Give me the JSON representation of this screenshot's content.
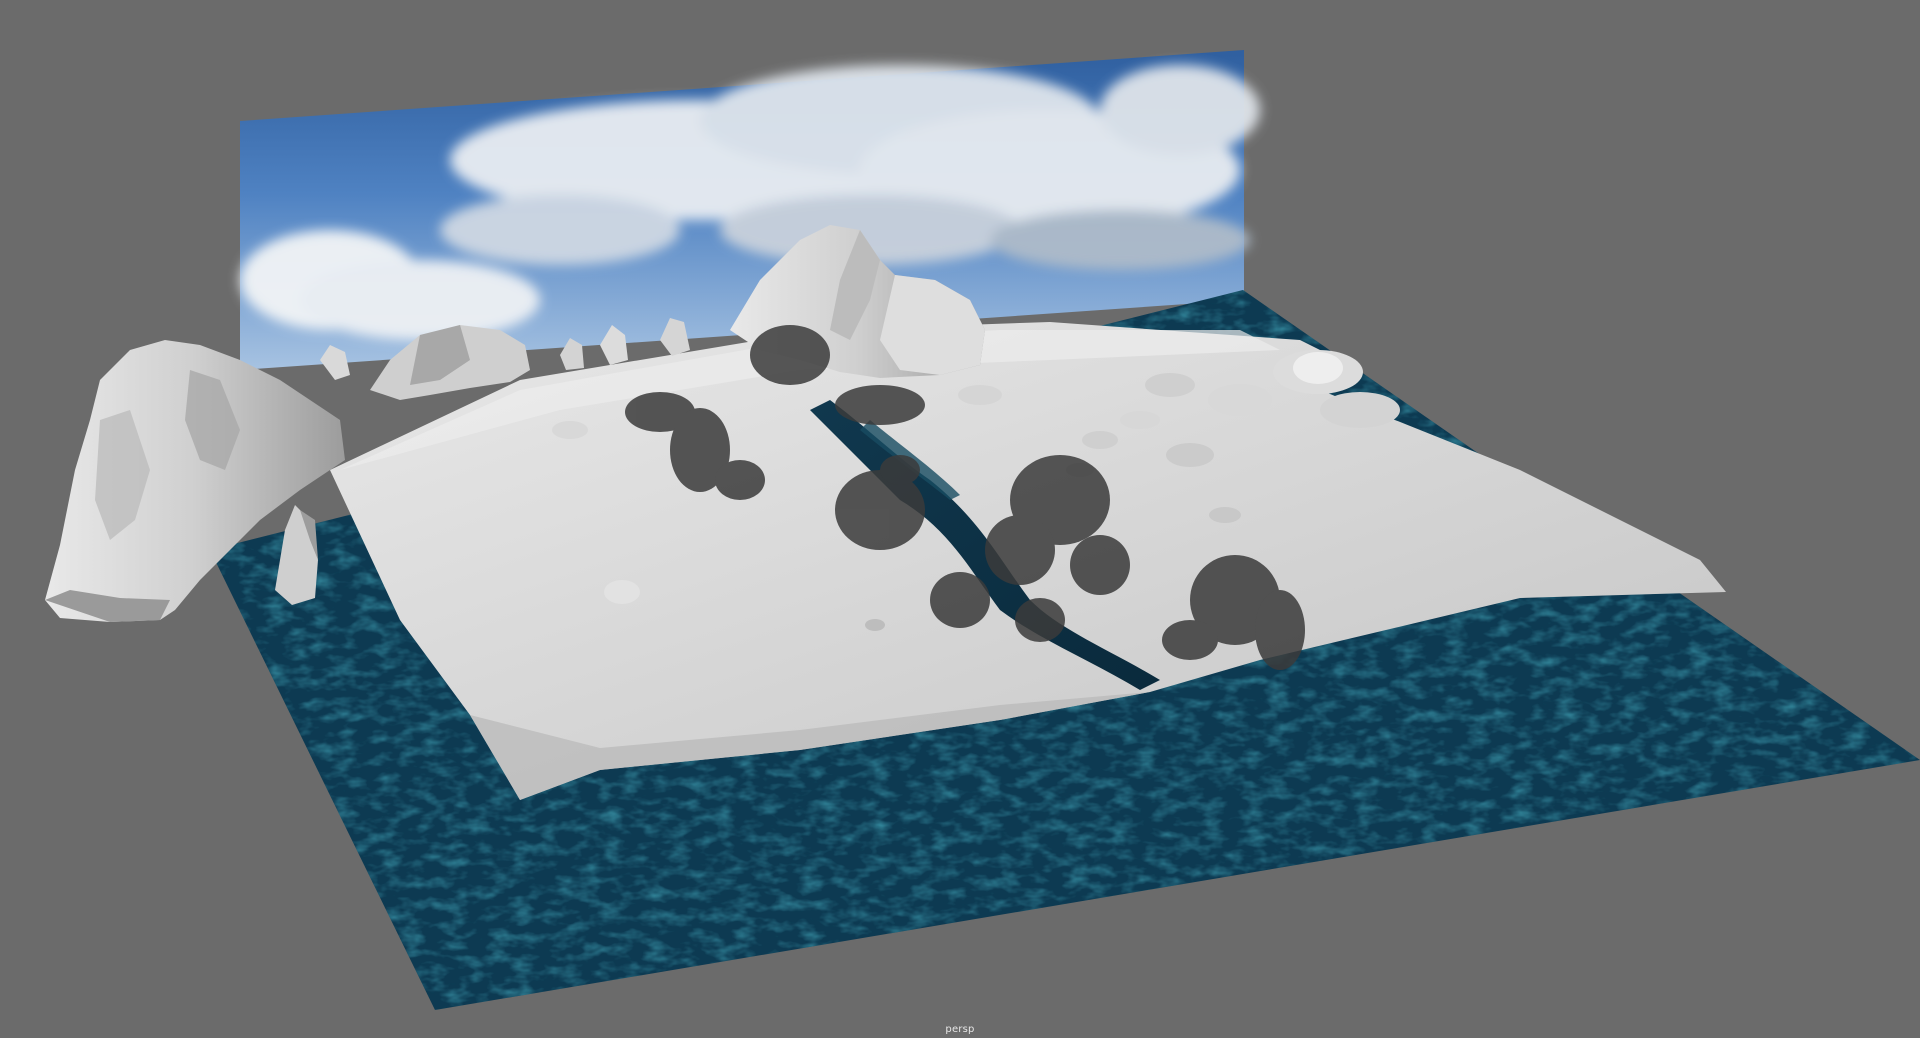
{
  "viewport": {
    "camera_label": "persp",
    "background_color": "#6b6b6b"
  },
  "scene": {
    "objects": [
      "sky-backdrop-plane",
      "ocean-ground-plane",
      "snow-terrain-mesh",
      "rock-cliff-formation",
      "rock-spires",
      "mountain-rock",
      "boulders",
      "river-channel",
      "trees"
    ],
    "colors": {
      "sky_top": "#3f73b8",
      "sky_bottom": "#8fb3dc",
      "cloud": "#e9edf2",
      "water_dark": "#0b3146",
      "water_light": "#2e7d95",
      "snow": "#d7d7d7",
      "tree": "#3a3a3a"
    }
  }
}
